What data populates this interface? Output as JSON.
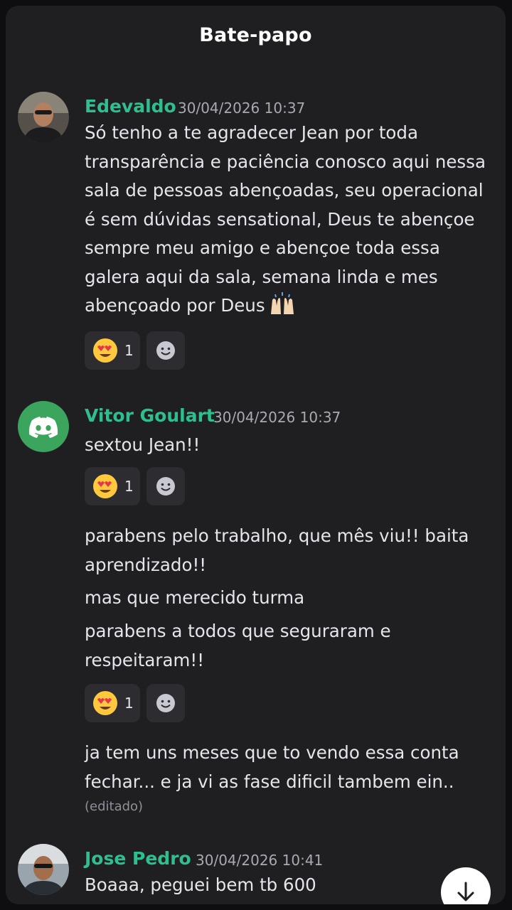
{
  "header": {
    "title": "Bate-papo"
  },
  "messages": [
    {
      "author": "Edevaldo",
      "timestamp": "30/04/2026 10:37",
      "avatar": "user-photo-avatar",
      "paragraphs": [
        "Só tenho a te agradecer Jean por toda\ntransparência e paciência conosco aqui nessa\nsala de pessoas abençoadas, seu operacional\né sem dúvidas sensational, Deus te abençoe\nsempre meu amigo e abençoe toda essa\ngalera aqui da sala, semana linda e mes\nabençoado por Deus"
      ],
      "inline_emoji": "raising-hands-emoji",
      "reactions": [
        {
          "emoji": "heart-eyes-emoji",
          "count": "1"
        }
      ]
    },
    {
      "author": "Vitor Goulart",
      "timestamp": "30/04/2026 10:37",
      "avatar": "discord-default-avatar",
      "avatar_color": "#3ba55d",
      "groups": [
        {
          "paragraphs": [
            "sextou Jean!!"
          ],
          "reactions": [
            {
              "emoji": "heart-eyes-emoji",
              "count": "1"
            }
          ]
        },
        {
          "paragraphs": [
            "parabens pelo trabalho, que mês viu!! baita\naprendizado!!",
            "mas que merecido turma",
            "parabens a todos que seguraram e\nrespeitaram!!"
          ],
          "reactions": [
            {
              "emoji": "heart-eyes-emoji",
              "count": "1"
            }
          ]
        },
        {
          "paragraphs": [
            "ja tem uns meses que to vendo essa conta\nfechar... e ja vi as fase dificil tambem ein.."
          ],
          "edited_label": "(editado)"
        }
      ]
    },
    {
      "author": "Jose Pedro",
      "timestamp": "30/04/2026 10:41",
      "avatar": "user-photo-avatar",
      "paragraphs": [
        "Boaaa, peguei bem tb 600"
      ]
    }
  ],
  "scroll_button": {
    "icon": "arrow-down-icon"
  },
  "colors": {
    "background": "#1f1f22",
    "author": "#2fbf8f",
    "text": "#e5e5ea",
    "timestamp": "#a9a9b2",
    "reaction_bg": "#2c2c31"
  }
}
